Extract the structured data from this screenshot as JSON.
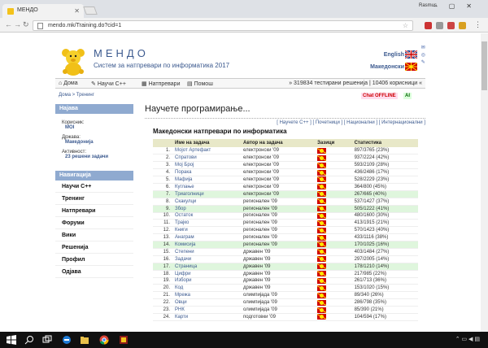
{
  "browser": {
    "tab_title": "МЕНДО",
    "url": "mendo.mk/Training.do?cid=1",
    "user": "Rasmus"
  },
  "header": {
    "site_title": "МЕНДО",
    "site_subtitle": "Систем за натпревари по информатика 2017",
    "lang_en": "English",
    "lang_mk": "Македонски"
  },
  "topnav": {
    "home": "Дома",
    "learn": "Научи C++",
    "contests": "Натпревари",
    "help": "Помош",
    "stats": "» 319834 тестирани решенија | 10406 корисници «"
  },
  "breadcrumb": "Дома > Тренинг",
  "chat": "Chat OFFLINE",
  "ai": "AI",
  "sidebar": {
    "login_head": "Најава",
    "user_label": "Корисник:",
    "user_value": "MOI",
    "country_label": "Држава:",
    "country_value": "Македонија",
    "activity_label": "Активност:",
    "activity_value": "23 решени задачи",
    "nav_head": "Навигација",
    "items": [
      "Научи C++",
      "Тренинг",
      "Натпревари",
      "Форуми",
      "Вики",
      "Решенија",
      "Профил",
      "Одјава"
    ]
  },
  "main": {
    "heading": "Научете програмирање...",
    "sublinks": "[ Научете C++ ]  [ Почетници ]  [ Национални ]  [ Интернационални ]",
    "section": "Македонски натпревари по информатика",
    "columns": [
      "",
      "Име на задача",
      "Автор на задача",
      "Зазици",
      "Статистика"
    ],
    "rows": [
      {
        "n": "1.",
        "name": "Мојот Артефакт",
        "author": "електронски '09",
        "stats": "897/3765 (23%)",
        "green": false
      },
      {
        "n": "2.",
        "name": "Спратови",
        "author": "електронски '09",
        "stats": "937/2224 (42%)",
        "green": false
      },
      {
        "n": "3.",
        "name": "Мој Број",
        "author": "електронски '09",
        "stats": "593/2109 (28%)",
        "green": false
      },
      {
        "n": "4.",
        "name": "Порака",
        "author": "електронски '09",
        "stats": "436/2486 (17%)",
        "green": false
      },
      {
        "n": "5.",
        "name": "Мафија",
        "author": "електронски '09",
        "stats": "528/2229 (23%)",
        "green": false
      },
      {
        "n": "6.",
        "name": "Куглање",
        "author": "електронски '09",
        "stats": "364/800 (45%)",
        "green": false
      },
      {
        "n": "7.",
        "name": "Триаголници",
        "author": "електронски '09",
        "stats": "267/665 (40%)",
        "green": true
      },
      {
        "n": "8.",
        "name": "Скакулци",
        "author": "регионален '09",
        "stats": "537/1427 (37%)",
        "green": false
      },
      {
        "n": "9.",
        "name": "Збор",
        "author": "регионален '09",
        "stats": "505/1222 (41%)",
        "green": true
      },
      {
        "n": "10.",
        "name": "Остаток",
        "author": "регионален '09",
        "stats": "480/1600 (30%)",
        "green": false
      },
      {
        "n": "11.",
        "name": "Трајко",
        "author": "регионален '09",
        "stats": "413/1915 (21%)",
        "green": false
      },
      {
        "n": "12.",
        "name": "Книги",
        "author": "регионален '09",
        "stats": "570/1423 (40%)",
        "green": false
      },
      {
        "n": "13.",
        "name": "Анаграм",
        "author": "регионален '09",
        "stats": "433/1116 (38%)",
        "green": false
      },
      {
        "n": "14.",
        "name": "Комисија",
        "author": "регионален '09",
        "stats": "170/1025 (16%)",
        "green": true
      },
      {
        "n": "15.",
        "name": "Степени",
        "author": "државен '09",
        "stats": "403/1484 (27%)",
        "green": false
      },
      {
        "n": "16.",
        "name": "Задачи",
        "author": "државен '09",
        "stats": "297/2005 (14%)",
        "green": false
      },
      {
        "n": "17.",
        "name": "Страница",
        "author": "државен '09",
        "stats": "178/1210 (14%)",
        "green": true
      },
      {
        "n": "18.",
        "name": "Цифри",
        "author": "државен '09",
        "stats": "217/985 (22%)",
        "green": false
      },
      {
        "n": "19.",
        "name": "Избори",
        "author": "државен '09",
        "stats": "261/713 (36%)",
        "green": false
      },
      {
        "n": "20.",
        "name": "Код",
        "author": "државен '09",
        "stats": "153/1020 (15%)",
        "green": false
      },
      {
        "n": "21.",
        "name": "Мрежа",
        "author": "олимпијада '09",
        "stats": "89/340 (26%)",
        "green": false
      },
      {
        "n": "22.",
        "name": "Овци",
        "author": "олимпијада '09",
        "stats": "286/798 (35%)",
        "green": false
      },
      {
        "n": "23.",
        "name": "РНК",
        "author": "олимпијада '09",
        "stats": "85/390 (21%)",
        "green": false
      },
      {
        "n": "24.",
        "name": "Карти",
        "author": "подготовки '09",
        "stats": "104/594 (17%)",
        "green": false
      }
    ]
  }
}
